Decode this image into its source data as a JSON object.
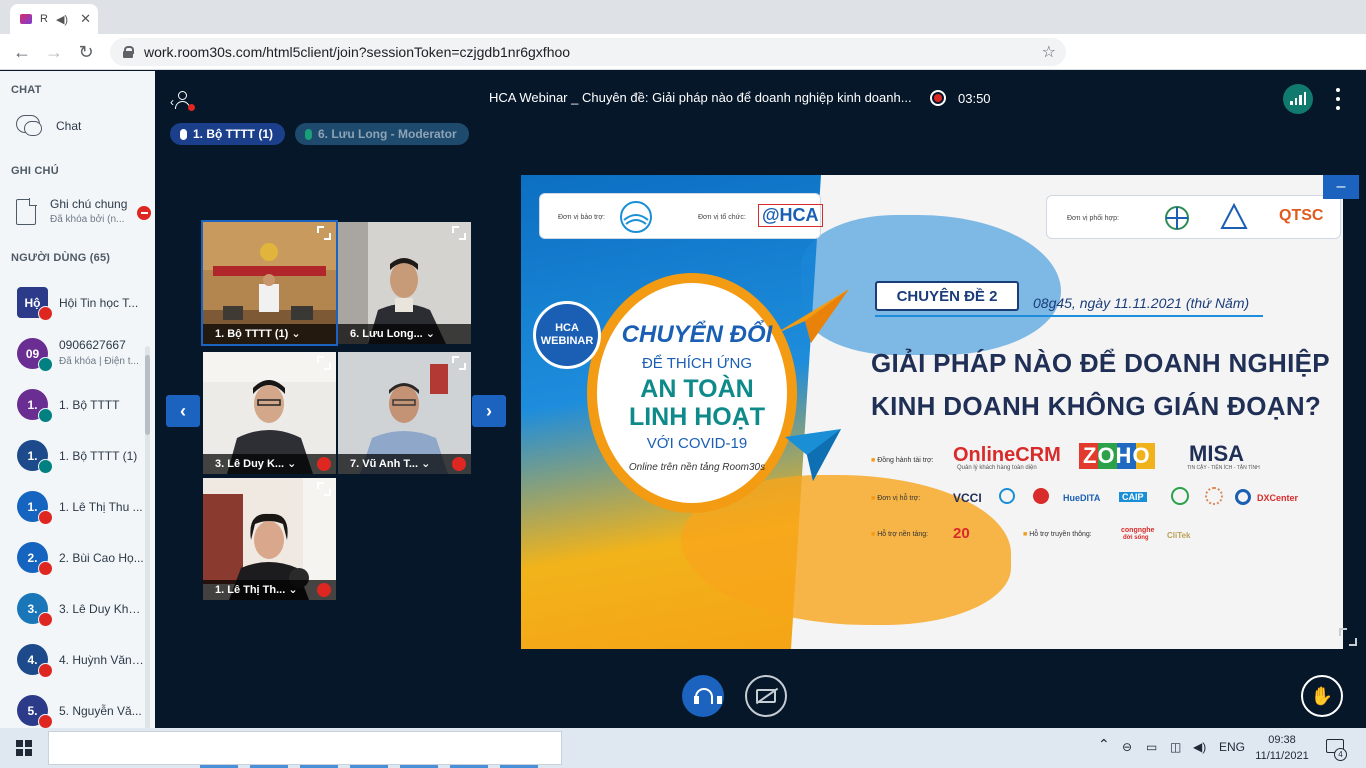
{
  "browser": {
    "tab_title": "R",
    "url": "work.room30s.com/html5client/join?sessionToken=czjgdb1nr6gxfhoo"
  },
  "sidebar": {
    "chat_section": "CHAT",
    "chat_label": "Chat",
    "notes_section": "GHI CHÚ",
    "note_title": "Ghi chú chung",
    "note_sub": "Đã khóa bởi (n...",
    "users_section": "NGƯỜI DÙNG (65)",
    "users": [
      {
        "avatar": "Hộ",
        "name": "Hội Tin học T...",
        "sub": "",
        "color": "#2c3a8a",
        "badge": "red",
        "square": true
      },
      {
        "avatar": "09",
        "name": "0906627667",
        "sub": "Đã khóa | Điện t...",
        "color": "#6a2d91",
        "badge": "green"
      },
      {
        "avatar": "1.",
        "name": "1. Bộ TTTT",
        "sub": "",
        "color": "#6a2d91",
        "badge": "green"
      },
      {
        "avatar": "1.",
        "name": "1. Bộ TTTT (1)",
        "sub": "",
        "color": "#1d4a8a",
        "badge": "green"
      },
      {
        "avatar": "1.",
        "name": "1. Lê Thị Thu ...",
        "sub": "",
        "color": "#1565c0",
        "badge": "red"
      },
      {
        "avatar": "2.",
        "name": "2. Bùi Cao Họ...",
        "sub": "",
        "color": "#1565c0",
        "badge": "red"
      },
      {
        "avatar": "3.",
        "name": "3. Lê Duy Kha...",
        "sub": "",
        "color": "#1976b8",
        "badge": "red"
      },
      {
        "avatar": "4.",
        "name": "4. Huỳnh Văn ...",
        "sub": "",
        "color": "#1d4a8a",
        "badge": "red"
      },
      {
        "avatar": "5.",
        "name": "5. Nguyễn Vă...",
        "sub": "",
        "color": "#2c3a8a",
        "badge": "red"
      }
    ]
  },
  "meeting": {
    "title": "HCA Webinar _ Chuyên đề: Giải pháp nào để doanh nghiệp kinh doanh...",
    "rec_time": "03:50",
    "talker_active": "1. Bộ TTTT (1)",
    "talker_idle": "6. Lưu Long - Moderator"
  },
  "videos": [
    {
      "name": "1. Bộ TTTT (1) ⌄"
    },
    {
      "name": "6. Lưu Long... ⌄"
    },
    {
      "name": "3. Lê Duy K... ⌄"
    },
    {
      "name": "7. Vũ Anh T... ⌄"
    },
    {
      "name": "1. Lê Thị Th... ⌄"
    }
  ],
  "slide": {
    "sponsor_label": "Đơn vị bảo trợ:",
    "organizer_label": "Đơn vị tổ chức:",
    "partner_label": "Đơn vị phối hợp:",
    "hca_logo": "@HCA",
    "qtsc_logo": "QTSC",
    "hca_badge_1": "HCA",
    "hca_badge_2": "WEBINAR",
    "main_1": "CHUYỂN ĐỔI",
    "main_2": "ĐỂ THÍCH ỨNG",
    "main_3": "AN TOÀN",
    "main_4": "LINH HOẠT",
    "main_5": "VỚI COVID-19",
    "main_6": "Online trên nền tảng Room30s",
    "topic_box": "CHUYÊN ĐỀ 2",
    "date": "08g45, ngày 11.11.2021 (thứ Năm)",
    "question_1": "GIẢI PHÁP NÀO ĐỂ DOANH NGHIỆP",
    "question_2": "KINH DOANH KHÔNG GIÁN ĐOẠN?",
    "companion_label": "Đồng hành tài trợ:",
    "support_label": "Đơn vị hỗ trợ:",
    "platform_label": "Hỗ trợ nền tảng:",
    "media_label": "Hỗ trợ truyền thông:",
    "logo_onlinecrm": "OnlineCRM",
    "logo_onlinecrm_sub": "Quản lý khách hàng toàn diện",
    "logo_zoho": "ZOHO",
    "logo_misa": "MISA",
    "logo_misa_sub": "TIN CẬY - TIỆN ÍCH - TẬN TÌNH",
    "logo_vcci": "VCCI",
    "logo_huedita": "HueDITA",
    "logo_caip": "CAIP",
    "logo_dxcenter": "DXCenter",
    "logo_20": "20",
    "logo_congnghe": "congnghe",
    "logo_congnghe_2": "đời sống",
    "logo_clitek": "CliTek"
  },
  "taskbar": {
    "lang": "ENG",
    "time": "09:38",
    "date": "11/11/2021",
    "notif_count": "4"
  }
}
